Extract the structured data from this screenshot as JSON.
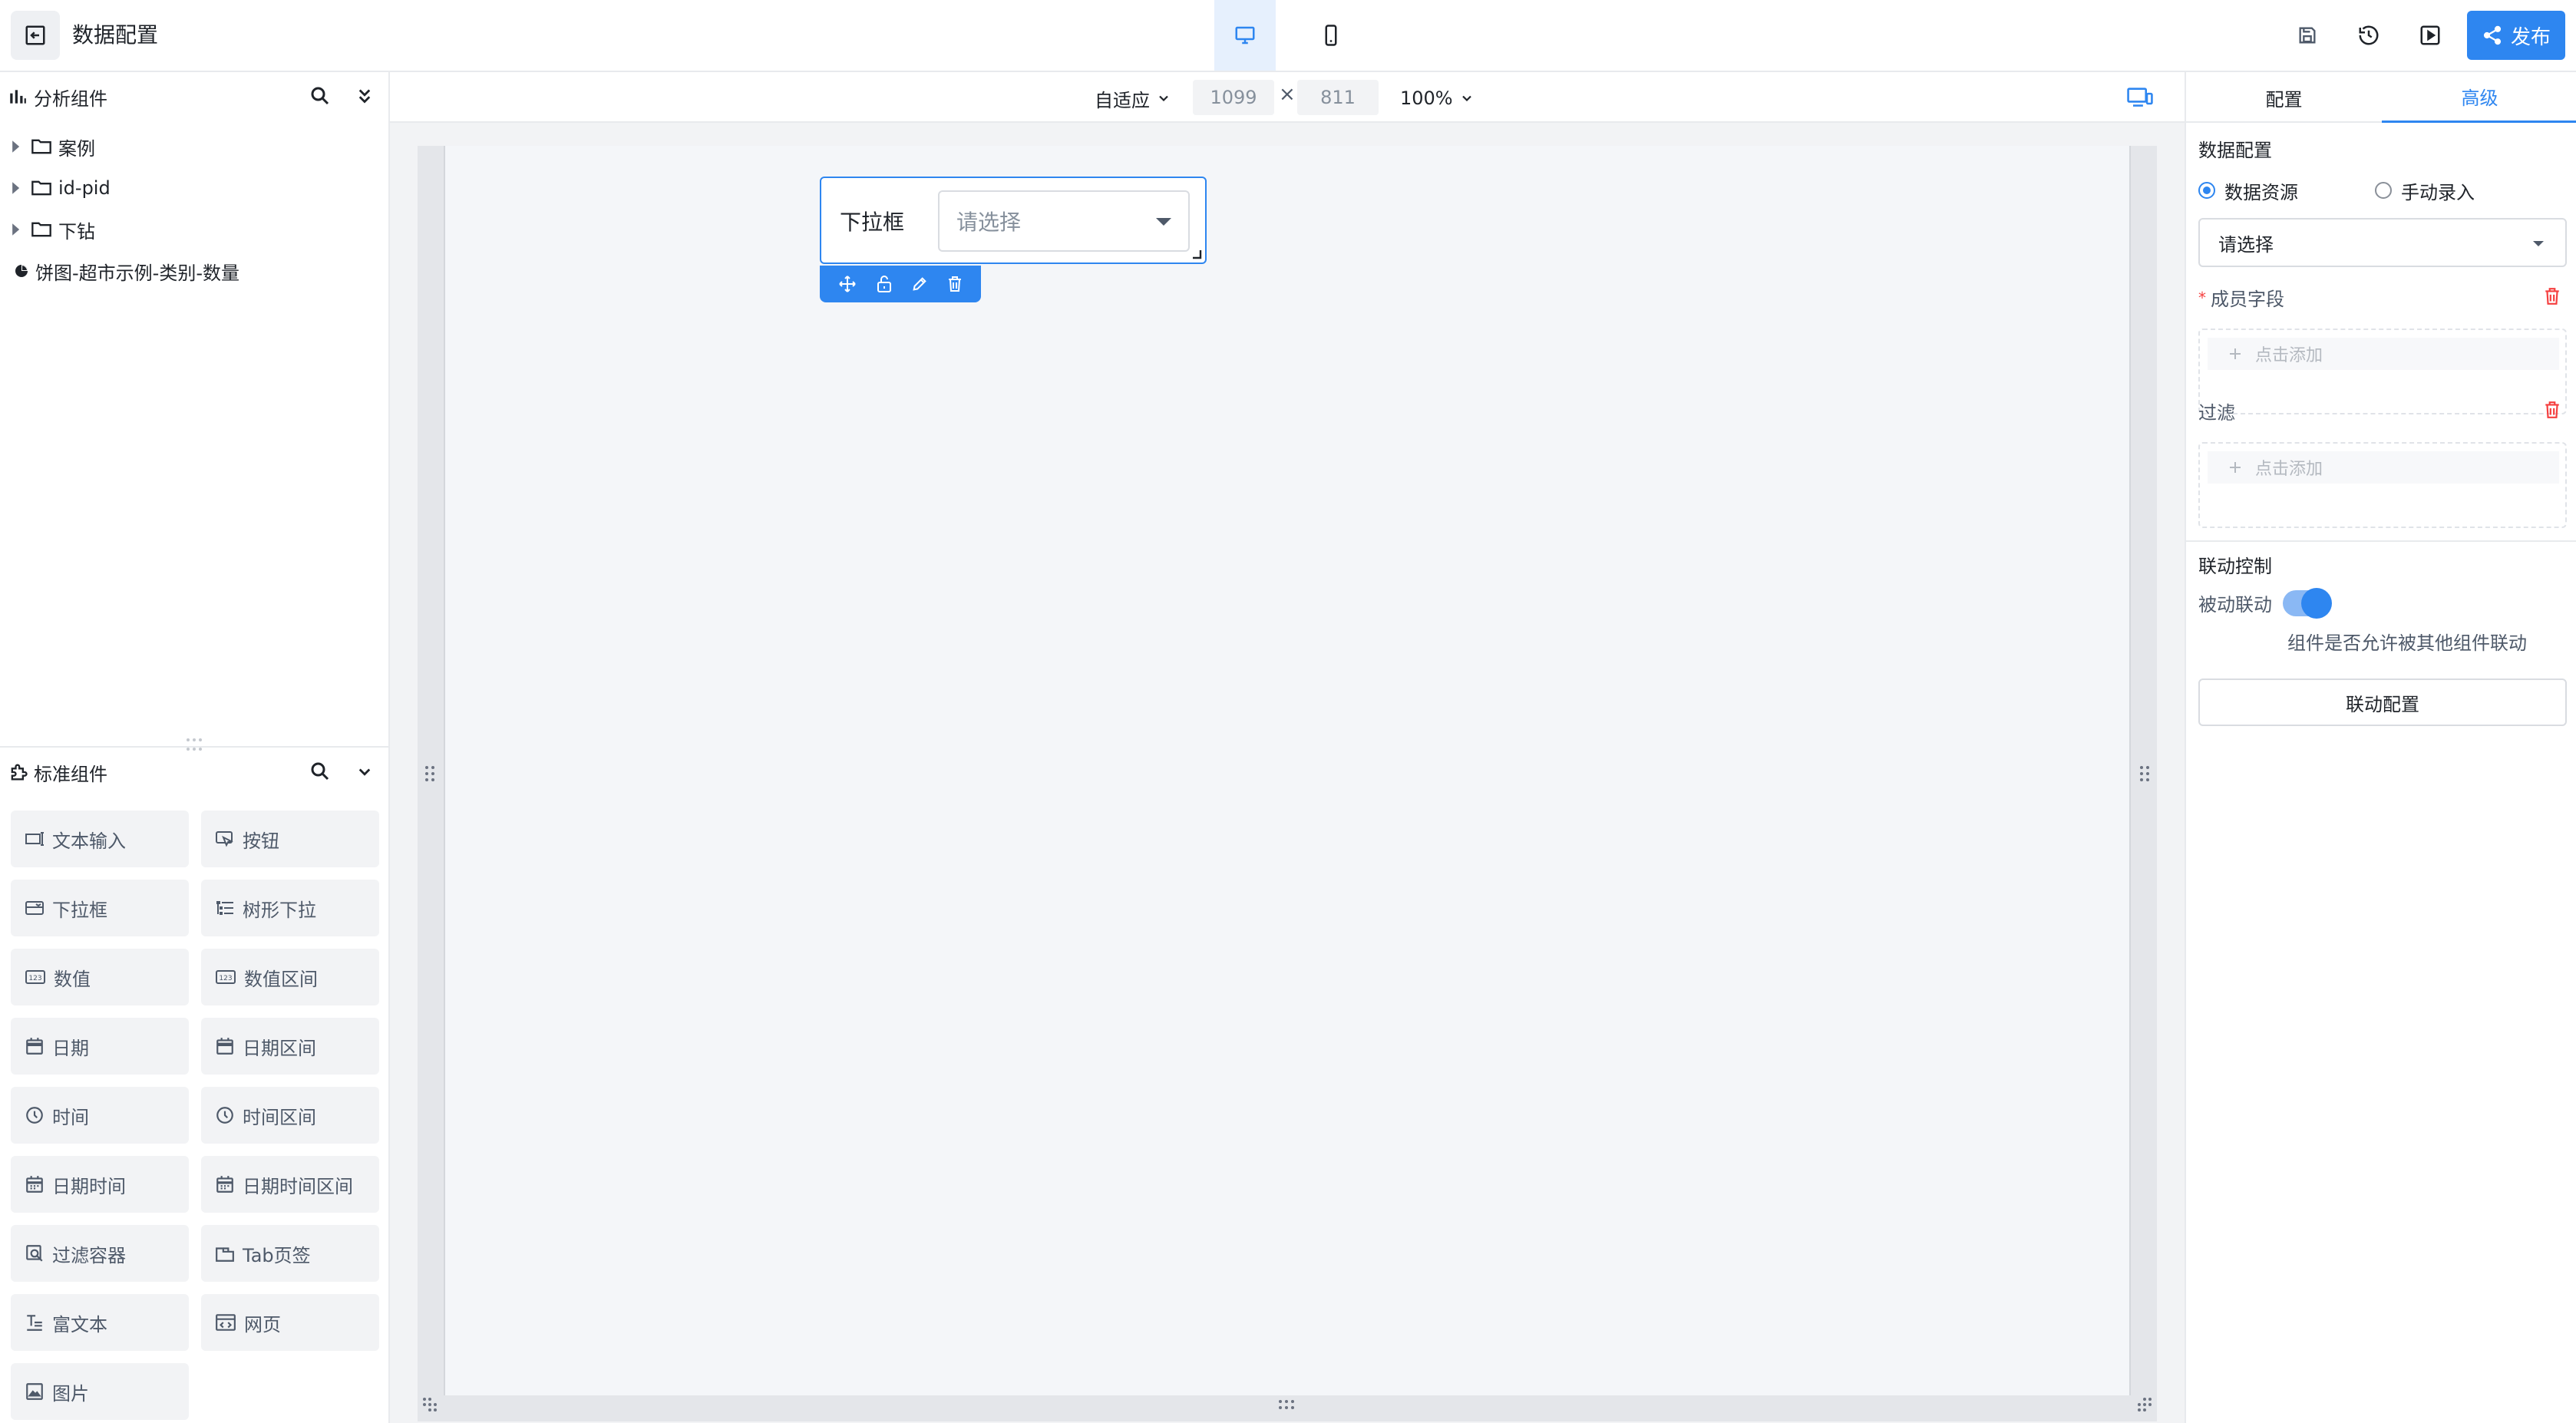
{
  "header": {
    "title": "数据配置",
    "publish_label": "发布"
  },
  "colors": {
    "accent": "#2e86f0",
    "danger": "#f53f3f"
  },
  "analysis_panel": {
    "title": "分析组件",
    "tree": [
      {
        "type": "folder",
        "label": "案例"
      },
      {
        "type": "folder",
        "label": "id-pid"
      },
      {
        "type": "folder",
        "label": "下钻"
      },
      {
        "type": "pie-chart",
        "label": "饼图-超市示例-类别-数量"
      }
    ]
  },
  "standard_panel": {
    "title": "标准组件",
    "items": [
      {
        "icon": "text-input-icon",
        "label": "文本输入"
      },
      {
        "icon": "button-icon",
        "label": "按钮"
      },
      {
        "icon": "dropdown-icon",
        "label": "下拉框"
      },
      {
        "icon": "tree-dropdown-icon",
        "label": "树形下拉"
      },
      {
        "icon": "number-icon",
        "label": "数值"
      },
      {
        "icon": "number-range-icon",
        "label": "数值区间"
      },
      {
        "icon": "calendar-icon",
        "label": "日期"
      },
      {
        "icon": "calendar-icon",
        "label": "日期区间"
      },
      {
        "icon": "clock-icon",
        "label": "时间"
      },
      {
        "icon": "clock-icon",
        "label": "时间区间"
      },
      {
        "icon": "datetime-icon",
        "label": "日期时间"
      },
      {
        "icon": "datetime-icon",
        "label": "日期时间区间"
      },
      {
        "icon": "filter-container-icon",
        "label": "过滤容器"
      },
      {
        "icon": "tab-icon",
        "label": "Tab页签"
      },
      {
        "icon": "rich-text-icon",
        "label": "富文本"
      },
      {
        "icon": "webpage-icon",
        "label": "网页"
      },
      {
        "icon": "image-icon",
        "label": "图片"
      }
    ]
  },
  "canvas_toolbar": {
    "adapt_label": "自适应",
    "width": "1099",
    "times": "×",
    "height": "811",
    "zoom": "100%"
  },
  "widget": {
    "label": "下拉框",
    "placeholder": "请选择"
  },
  "right_panel": {
    "tabs": [
      "配置",
      "高级"
    ],
    "active_tab": "高级",
    "data_config_title": "数据配置",
    "radio_options": [
      "数据资源",
      "手动录入"
    ],
    "radio_selected": "数据资源",
    "resource_select_value": "请选择",
    "member_field_required": "*",
    "member_field_label": "成员字段",
    "member_add_label": "点击添加",
    "filter_label": "过滤",
    "filter_add_label": "点击添加",
    "linkage_title": "联动控制",
    "passive_linkage_label": "被动联动",
    "passive_linkage_enabled": true,
    "passive_linkage_hint": "组件是否允许被其他组件联动",
    "linkage_config_button": "联动配置"
  }
}
